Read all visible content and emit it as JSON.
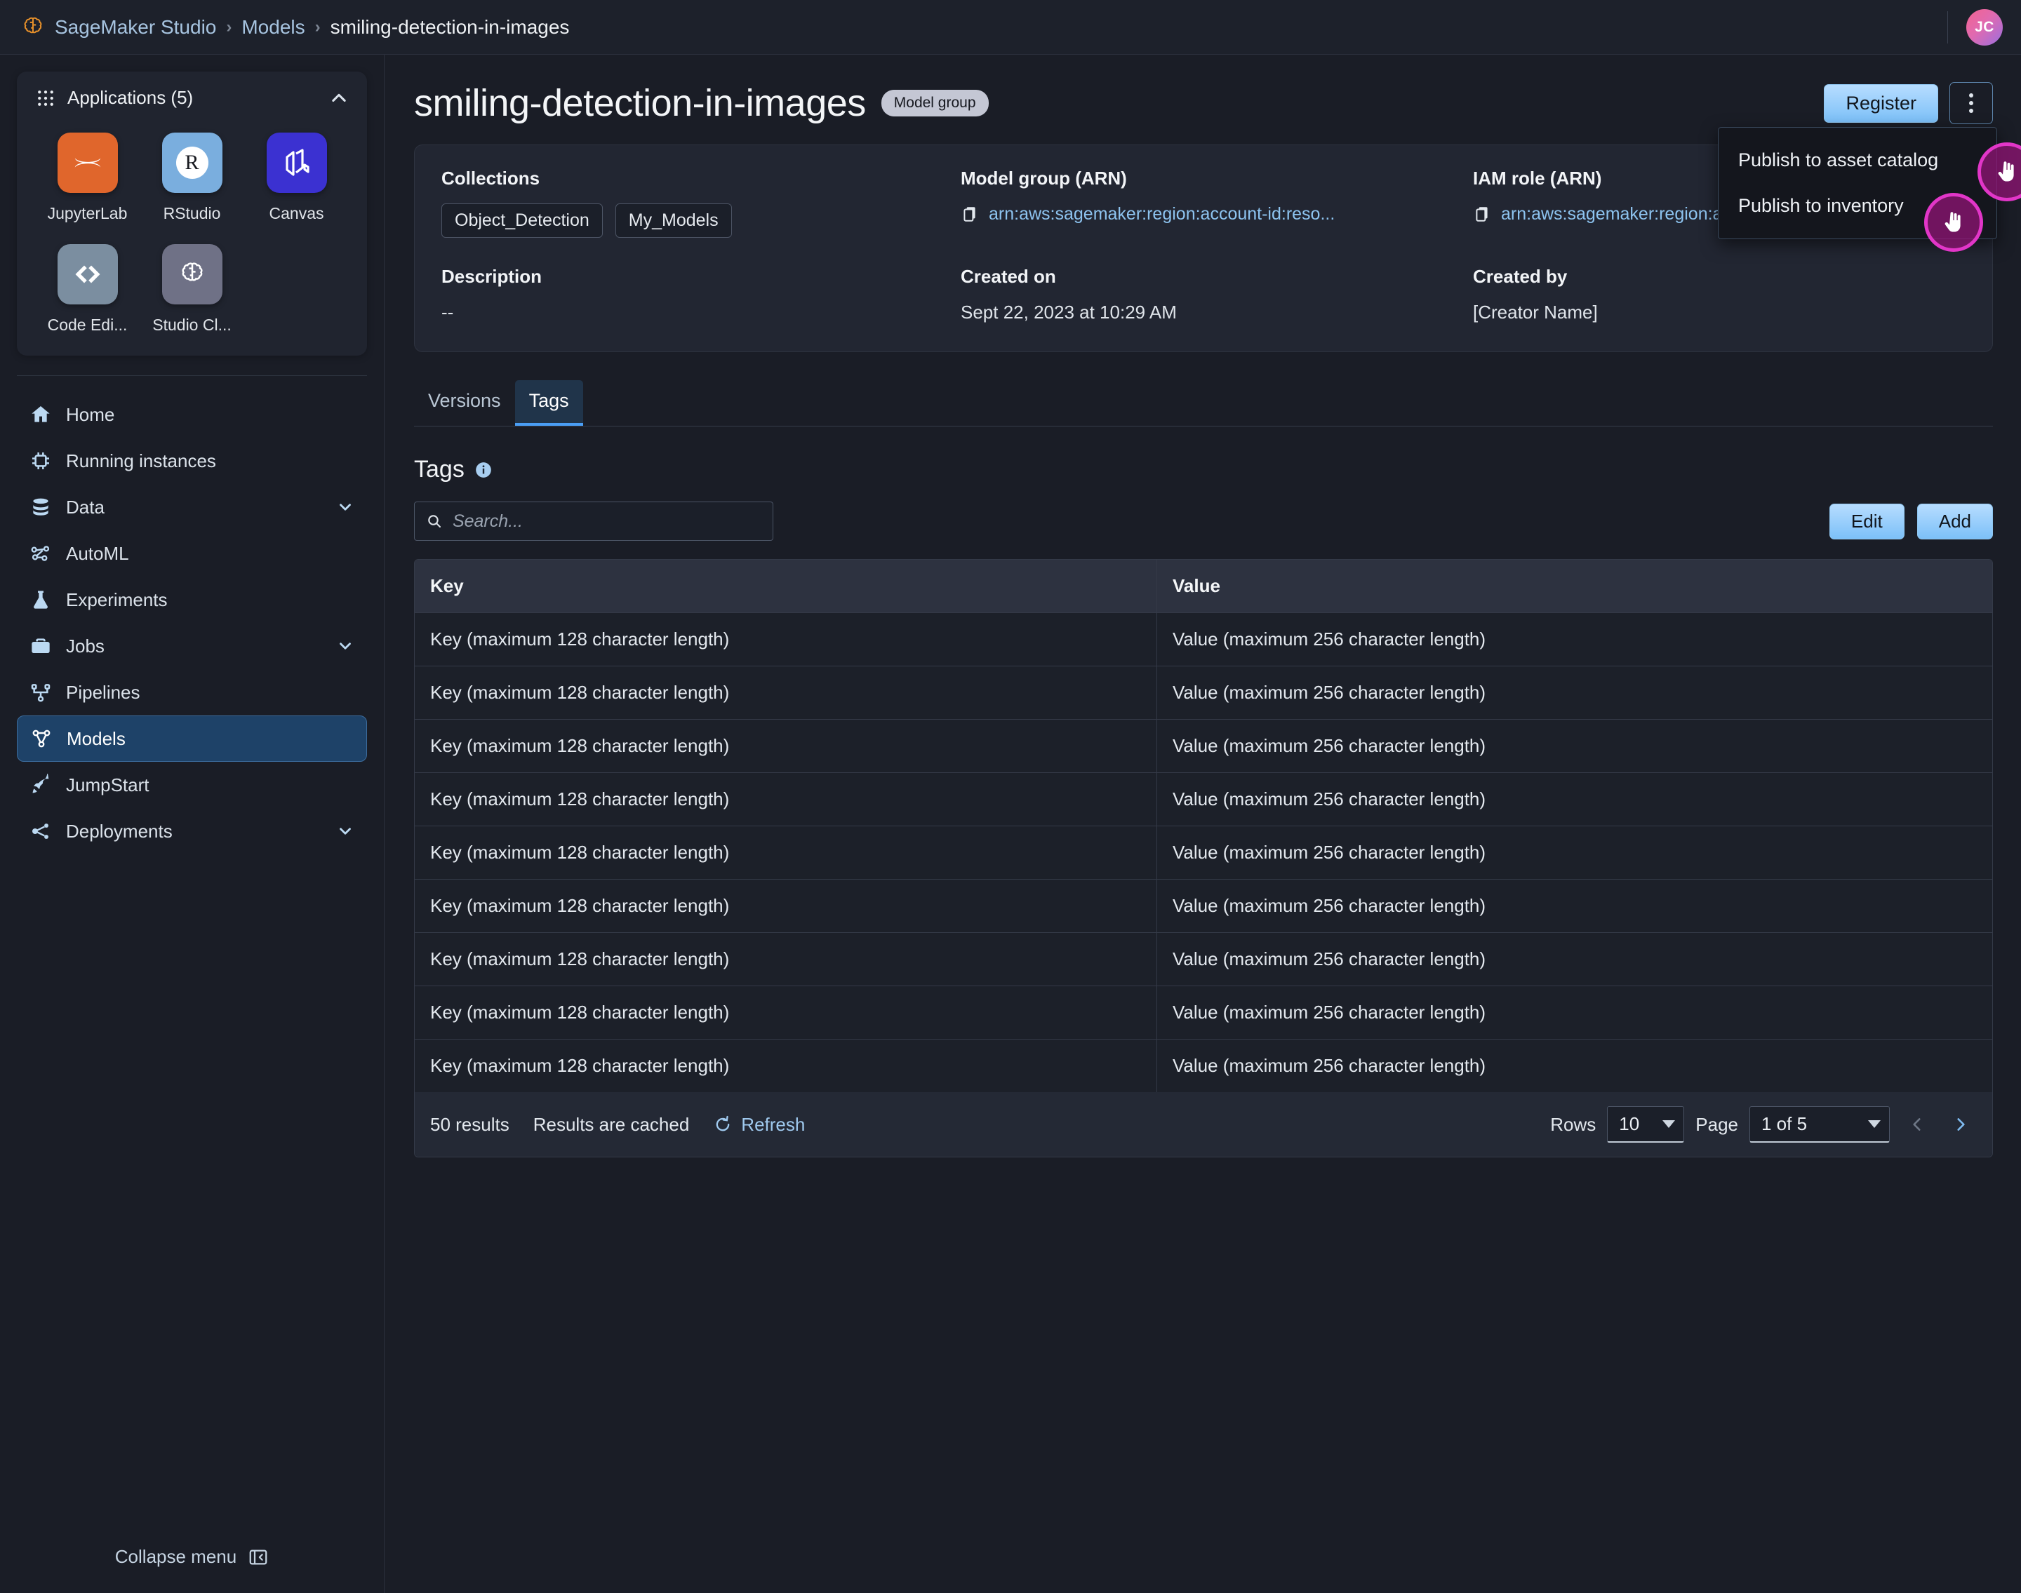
{
  "topbar": {
    "logo_icon": "sagemaker-brain-logo",
    "breadcrumb": [
      {
        "label": "SageMaker Studio",
        "type": "link"
      },
      {
        "label": "Models",
        "type": "link"
      },
      {
        "label": "smiling-detection-in-images",
        "type": "current"
      }
    ],
    "separator": "›",
    "avatar_initials": "JC"
  },
  "sidebar": {
    "applications": {
      "title": "Applications (5)",
      "grid_icon": "apps-grid-icon",
      "collapse_icon": "chevron-up-icon",
      "apps": [
        {
          "label": "JupyterLab",
          "icon": "jupyterlab-icon",
          "bg": "#e0662c"
        },
        {
          "label": "RStudio",
          "icon": "rstudio-icon",
          "bg": "#7aaede"
        },
        {
          "label": "Canvas",
          "icon": "canvas-icon",
          "bg": "#3b31d1"
        },
        {
          "label": "Code Edi...",
          "icon": "code-editor-icon",
          "bg": "#7b8ea0"
        },
        {
          "label": "Studio Cl...",
          "icon": "studio-classic-icon",
          "bg": "#6f7186"
        }
      ]
    },
    "nav": [
      {
        "label": "Home",
        "icon": "home-icon",
        "active": false,
        "caret": false
      },
      {
        "label": "Running instances",
        "icon": "chip-icon",
        "active": false,
        "caret": false
      },
      {
        "label": "Data",
        "icon": "database-icon",
        "active": false,
        "caret": true
      },
      {
        "label": "AutoML",
        "icon": "automl-icon",
        "active": false,
        "caret": false
      },
      {
        "label": "Experiments",
        "icon": "flask-icon",
        "active": false,
        "caret": false
      },
      {
        "label": "Jobs",
        "icon": "briefcase-icon",
        "active": false,
        "caret": true
      },
      {
        "label": "Pipelines",
        "icon": "pipeline-icon",
        "active": false,
        "caret": false
      },
      {
        "label": "Models",
        "icon": "models-icon",
        "active": true,
        "caret": false
      },
      {
        "label": "JumpStart",
        "icon": "rocket-icon",
        "active": false,
        "caret": false
      },
      {
        "label": "Deployments",
        "icon": "share-icon",
        "active": false,
        "caret": true
      }
    ],
    "collapse": {
      "label": "Collapse menu",
      "icon": "panel-collapse-icon"
    }
  },
  "page": {
    "title": "smiling-detection-in-images",
    "badge": "Model group",
    "register_button": "Register",
    "kebab_icon": "more-vertical-icon",
    "dropdown": {
      "items": [
        "Publish to asset catalog",
        "Publish to inventory"
      ]
    }
  },
  "info_card": {
    "collections": {
      "label": "Collections",
      "chips": [
        "Object_Detection",
        "My_Models"
      ]
    },
    "description": {
      "label": "Description",
      "value": "--"
    },
    "model_group_arn": {
      "label": "Model group (ARN)",
      "value": "arn:aws:sagemaker:region:account-id:reso...",
      "copy_icon": "copy-icon"
    },
    "created_on": {
      "label": "Created on",
      "value": "Sept 22, 2023 at 10:29 AM"
    },
    "iam_role_arn": {
      "label": "IAM role (ARN)",
      "value": "arn:aws:sagemaker:region:account-id:reso...",
      "copy_icon": "copy-icon"
    },
    "created_by": {
      "label": "Created by",
      "value": "[Creator Name]"
    }
  },
  "tabs": [
    {
      "label": "Versions",
      "active": false
    },
    {
      "label": "Tags",
      "active": true
    }
  ],
  "tags_section": {
    "title": "Tags",
    "info_icon": "info-circle-icon",
    "search": {
      "placeholder": "Search...",
      "value": "",
      "icon": "search-icon"
    },
    "edit_button": "Edit",
    "add_button": "Add",
    "table": {
      "columns": [
        "Key",
        "Value"
      ],
      "rows": [
        [
          "Key (maximum 128 character length)",
          "Value (maximum 256 character length)"
        ],
        [
          "Key (maximum 128 character length)",
          "Value (maximum 256 character length)"
        ],
        [
          "Key (maximum 128 character length)",
          "Value (maximum 256 character length)"
        ],
        [
          "Key (maximum 128 character length)",
          "Value (maximum 256 character length)"
        ],
        [
          "Key (maximum 128 character length)",
          "Value (maximum 256 character length)"
        ],
        [
          "Key (maximum 128 character length)",
          "Value (maximum 256 character length)"
        ],
        [
          "Key (maximum 128 character length)",
          "Value (maximum 256 character length)"
        ],
        [
          "Key (maximum 128 character length)",
          "Value (maximum 256 character length)"
        ],
        [
          "Key (maximum 128 character length)",
          "Value (maximum 256 character length)"
        ]
      ]
    },
    "footer": {
      "results": "50 results",
      "cached": "Results are cached",
      "refresh": "Refresh",
      "refresh_icon": "refresh-icon",
      "rows_label": "Rows",
      "rows_value": "10",
      "page_label": "Page",
      "page_value": "1 of 5",
      "prev_icon": "chevron-left-icon",
      "next_icon": "chevron-right-icon"
    }
  },
  "colors": {
    "accent_blue": "#7cc0f8",
    "active_nav": "#1e4268",
    "cursor_ring": "#e236c8",
    "app_jupyter": "#e0662c",
    "app_rstudio": "#7aaede",
    "app_canvas": "#3b31d1"
  }
}
